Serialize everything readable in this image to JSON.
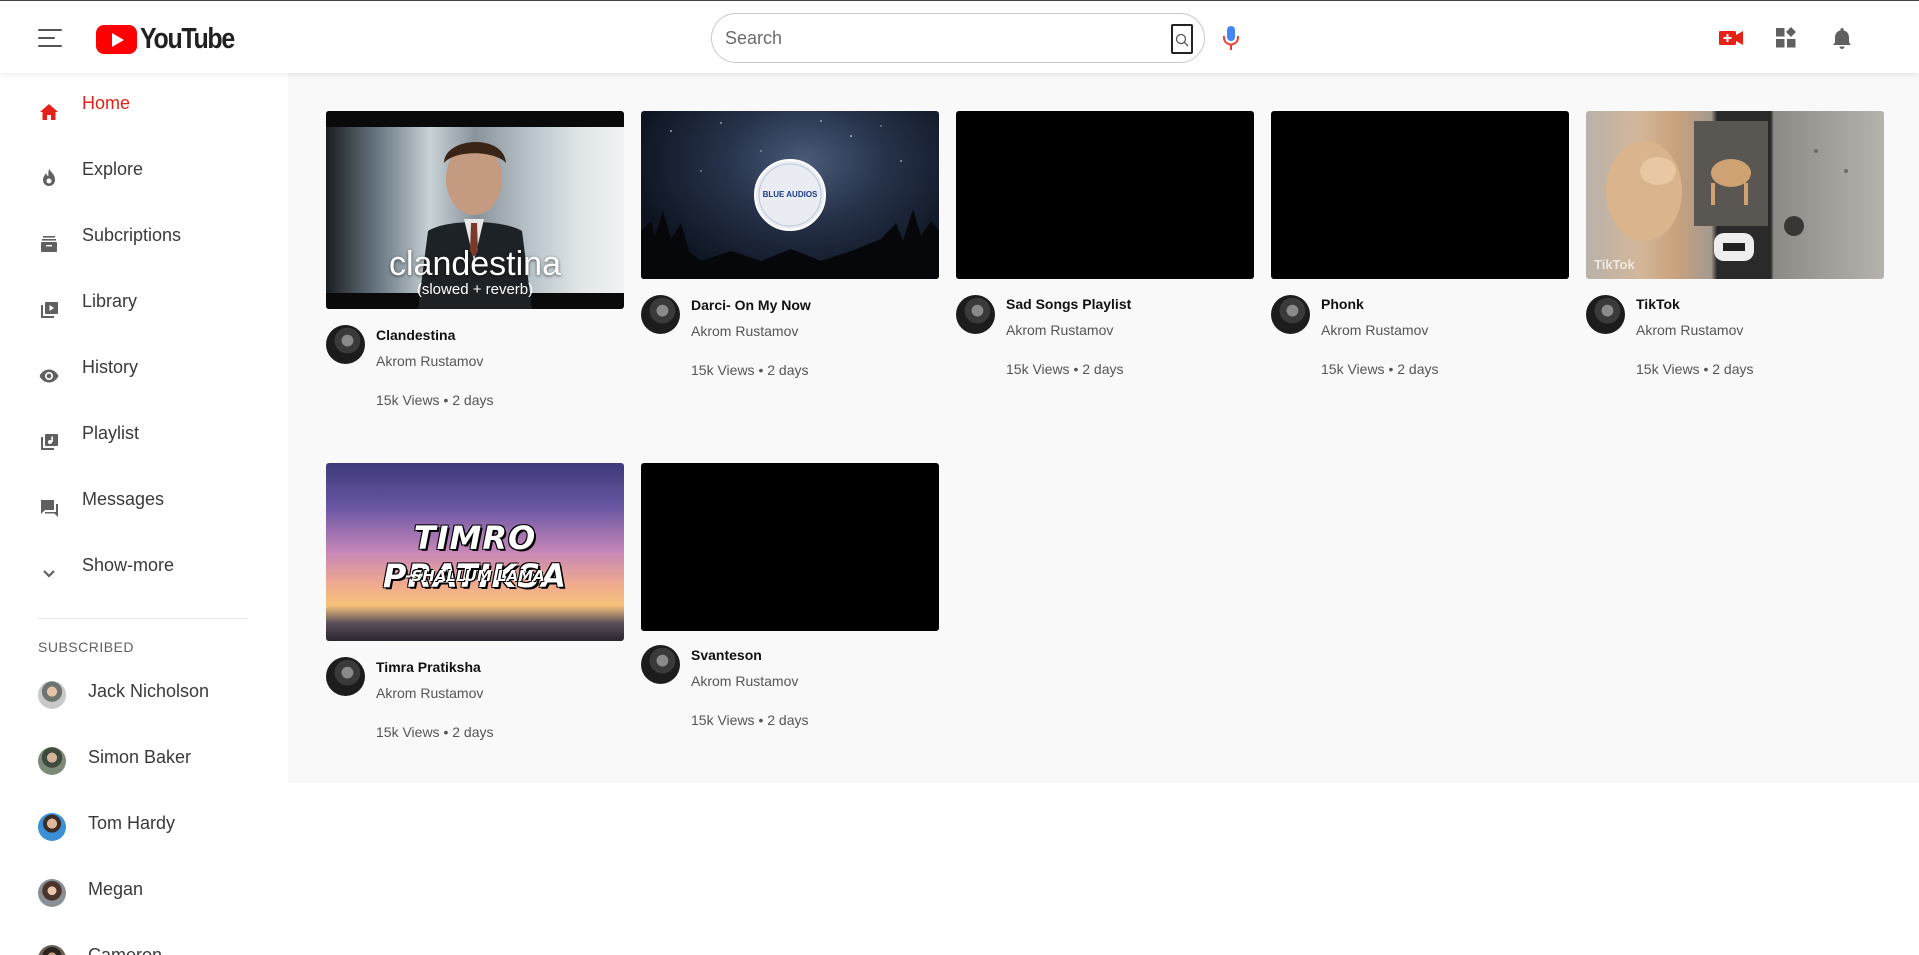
{
  "header": {
    "logo_text": "YouTube",
    "search_placeholder": "Search"
  },
  "sidebar": {
    "items": [
      {
        "label": "Home",
        "icon": "home-icon",
        "active": true
      },
      {
        "label": "Explore",
        "icon": "explore-icon"
      },
      {
        "label": "Subcriptions",
        "icon": "subscriptions-icon"
      },
      {
        "label": "Library",
        "icon": "library-icon"
      },
      {
        "label": "History",
        "icon": "history-icon"
      },
      {
        "label": "Playlist",
        "icon": "playlist-icon"
      },
      {
        "label": "Messages",
        "icon": "messages-icon"
      },
      {
        "label": "Show-more",
        "icon": "chevron-down-icon"
      }
    ],
    "subscribed_title": "SUBSCRIBED",
    "subscriptions": [
      {
        "name": "Jack Nicholson"
      },
      {
        "name": "Simon Baker"
      },
      {
        "name": "Tom Hardy"
      },
      {
        "name": "Megan"
      },
      {
        "name": "Cameron"
      }
    ]
  },
  "videos": [
    {
      "title": "Clandestina",
      "channel": "Akrom Rustamov",
      "meta": "15k Views • 2 days",
      "thumb_title": "clandestina",
      "thumb_subtitle": "(slowed + reverb)"
    },
    {
      "title": "Darci- On My Now",
      "channel": "Akrom Rustamov",
      "meta": "15k Views • 2 days",
      "thumb_badge": "BLUE AUDIOS"
    },
    {
      "title": "Sad Songs Playlist",
      "channel": "Akrom Rustamov",
      "meta": "15k Views • 2 days"
    },
    {
      "title": "Phonk",
      "channel": "Akrom Rustamov",
      "meta": "15k Views • 2 days"
    },
    {
      "title": "TikTok",
      "channel": "Akrom Rustamov",
      "meta": "15k Views • 2 days",
      "thumb_watermark": "TikTok"
    },
    {
      "title": "Timra Pratiksha",
      "channel": "Akrom Rustamov",
      "meta": "15k Views • 2 days",
      "thumb_title": "TIMRO PRATIKSA",
      "thumb_subtitle": "-SHALLUM LAMA"
    },
    {
      "title": "Svanteson",
      "channel": "Akrom Rustamov",
      "meta": "15k Views • 2 days"
    }
  ],
  "colors": {
    "accent": "#e62117",
    "brand_red": "#ff0000",
    "main_bg": "#f9f9f9"
  }
}
